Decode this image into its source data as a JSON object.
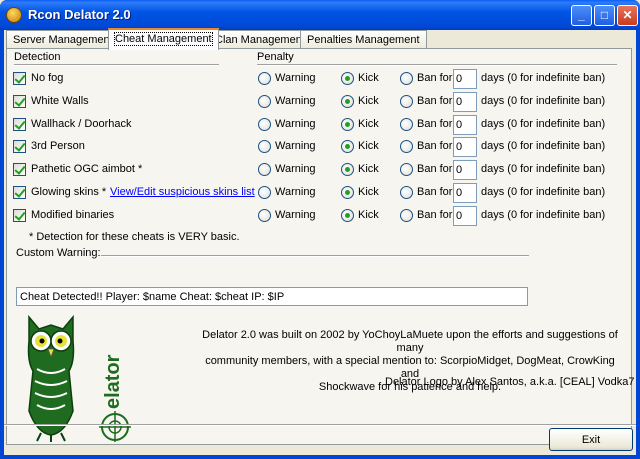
{
  "window": {
    "title": "Rcon Delator 2.0",
    "minimize": "_",
    "maximize": "□",
    "close": "✕"
  },
  "tabs": [
    {
      "label": "Server Management"
    },
    {
      "label": "Cheat Management"
    },
    {
      "label": "Clan Management"
    },
    {
      "label": "Penalties Management"
    }
  ],
  "headers": {
    "detection": "Detection",
    "penalty": "Penalty"
  },
  "penalty_labels": {
    "warning": "Warning",
    "kick": "Kick",
    "ban_for": "Ban for",
    "days_note": "days (0 for indefinite ban)"
  },
  "cheats": [
    {
      "name": "No fog",
      "checked": true,
      "penalty": "kick",
      "days": "0"
    },
    {
      "name": "White Walls",
      "checked": true,
      "penalty": "kick",
      "days": "0"
    },
    {
      "name": "Wallhack / Doorhack",
      "checked": true,
      "penalty": "kick",
      "days": "0"
    },
    {
      "name": "3rd Person",
      "checked": true,
      "penalty": "kick",
      "days": "0"
    },
    {
      "name": "Pathetic OGC aimbot *",
      "checked": true,
      "penalty": "kick",
      "days": "0"
    },
    {
      "name": "Glowing skins *",
      "checked": true,
      "penalty": "kick",
      "days": "0"
    },
    {
      "name": "Modified binaries",
      "checked": true,
      "penalty": "kick",
      "days": "0"
    }
  ],
  "glowing_link": "View/Edit suspicious skins list",
  "basic_note": "* Detection for these cheats is VERY basic.",
  "custom_warning": {
    "label": "Custom Warning:",
    "value": "Cheat Detected!! Player: $name Cheat: $cheat IP: $IP"
  },
  "credits": {
    "line1": "Delator 2.0 was built on 2002 by YoChoyLaMuete upon the efforts and suggestions of many",
    "line2": "community members, with a special mention to: ScorpioMidget, DogMeat, CrowKing and",
    "line3": "Shockwave for his patience and help.",
    "logo_credit": "Delator Logo by Alex Santos, a.k.a. [CEAL] Vodka7"
  },
  "logo_text": "elator",
  "exit_label": "Exit"
}
